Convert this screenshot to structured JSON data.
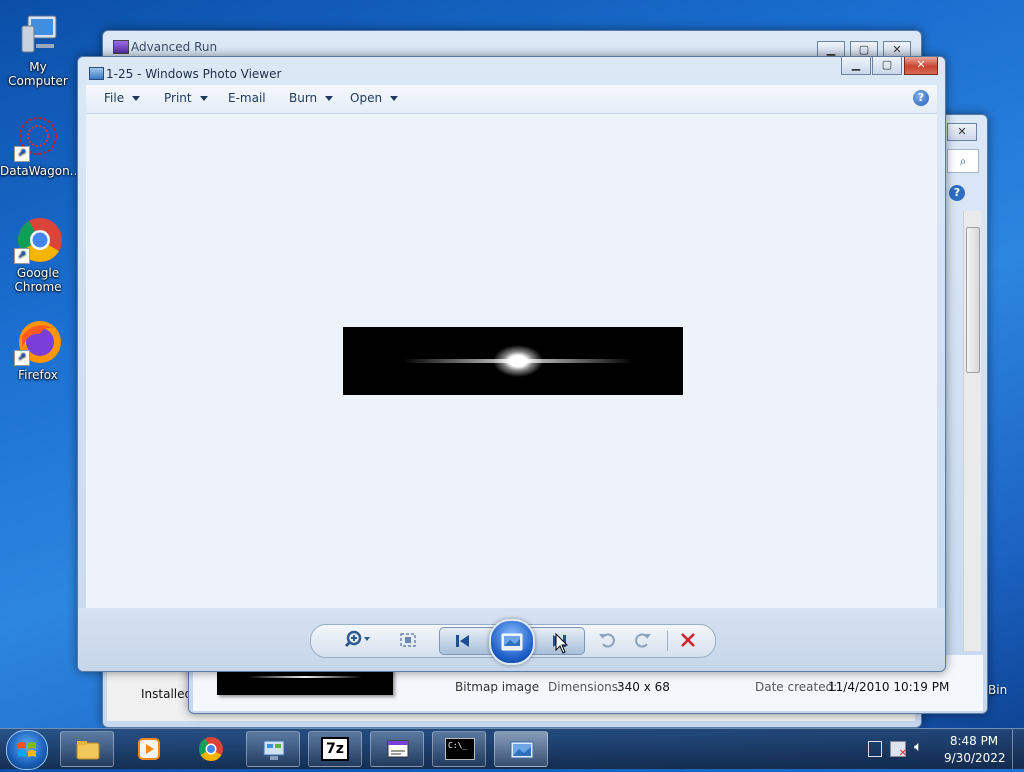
{
  "desktop": {
    "icons": [
      {
        "label": "My Computer"
      },
      {
        "label": "DataWagon..."
      },
      {
        "label": "Google Chrome"
      },
      {
        "label": "Firefox"
      }
    ],
    "recycle_label": "Bin"
  },
  "background_windows": {
    "advanced_run": {
      "title": "Advanced Run"
    },
    "details": {
      "installed_label": "Installed",
      "file_type": "Bitmap image",
      "dimensions_label": "Dimensions:",
      "dimensions_value": "340 x 68",
      "date_created_label": "Date created:",
      "date_created_value": "11/4/2010 10:19 PM"
    }
  },
  "photo_viewer": {
    "title": "1-25 - Windows Photo Viewer",
    "menu": [
      {
        "label": "File",
        "has_arrow": true
      },
      {
        "label": "Print",
        "has_arrow": true
      },
      {
        "label": "E-mail",
        "has_arrow": false
      },
      {
        "label": "Burn",
        "has_arrow": true
      },
      {
        "label": "Open",
        "has_arrow": true
      }
    ],
    "image_size": "340 x 68"
  },
  "taskbar": {
    "time": "8:48 PM",
    "date": "9/30/2022",
    "seven_zip": "7z",
    "cmd_text": "C:\\_"
  },
  "colors": {
    "accent": "#1e395b",
    "close_red": "#c9452f",
    "delete_red": "#d0202a"
  }
}
